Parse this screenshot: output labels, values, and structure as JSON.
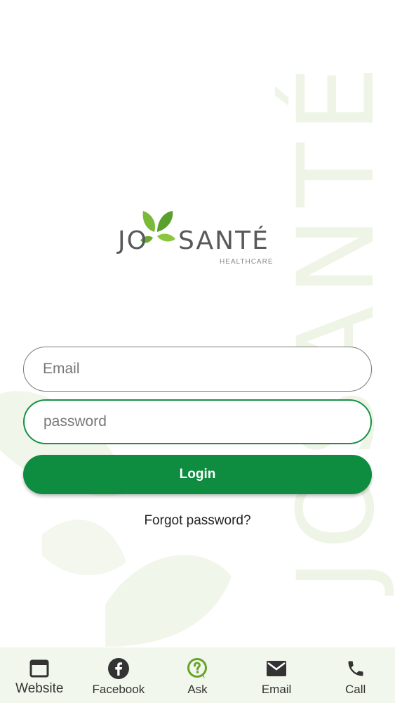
{
  "watermark": {
    "text": "JOSANTÉ"
  },
  "logo": {
    "jo": "JO",
    "sante": "SANTÉ",
    "healthcare": "HEALTHCARE"
  },
  "form": {
    "email_placeholder": "Email",
    "password_placeholder": "password",
    "login_label": "Login",
    "forgot_label": "Forgot password?"
  },
  "nav": {
    "items": [
      {
        "label": "Website",
        "icon": "browser-window-icon"
      },
      {
        "label": "Facebook",
        "icon": "facebook-icon"
      },
      {
        "label": "Ask",
        "icon": "question-bubble-icon"
      },
      {
        "label": "Email",
        "icon": "envelope-icon"
      },
      {
        "label": "Call",
        "icon": "phone-icon"
      }
    ]
  },
  "colors": {
    "brand_green": "#0e8c3f",
    "leaf_green": "#7bb93a",
    "nav_background": "#f1f7ec"
  }
}
